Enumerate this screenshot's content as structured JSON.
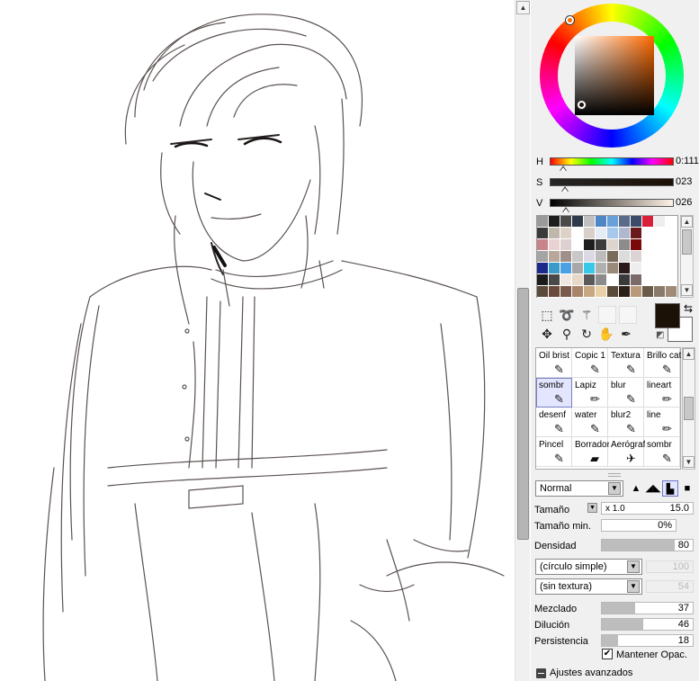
{
  "colors": {
    "main_color": "#1c1106",
    "sub_color": "#ffffff",
    "hue_marker": "#ff6a00"
  },
  "color_sliders": [
    {
      "label": "H",
      "value": "0:111",
      "caret_fraction": 0.07
    },
    {
      "label": "S",
      "value": "023",
      "caret_fraction": 0.09
    },
    {
      "label": "V",
      "value": "026",
      "caret_fraction": 0.1
    }
  ],
  "swatches": [
    "#9a9a9a",
    "#1d1d1d",
    "#4a4a4a",
    "#2f3a4a",
    "#c0c0c0",
    "#4f86c4",
    "#6aa0d8",
    "#5a6c8a",
    "#3a4c6a",
    "#d8203a",
    "#eeeeee",
    "#ffffff",
    "#3a3a3a",
    "#bfb6ac",
    "#dcd2c8",
    "#ffffff",
    "#d8d0c8",
    "#e6ecf5",
    "#a6c8ec",
    "#b0b8d0",
    "#6a1a1a",
    "#ffffff",
    "#ffffff",
    "#ffffff",
    "#c8848a",
    "#e8d2d2",
    "#dcd0d0",
    "#ffffff",
    "#1e1e1e",
    "#3c3c3c",
    "#dcd4ce",
    "#8c8c8c",
    "#7a0a0a",
    "#ffffff",
    "#ffffff",
    "#ffffff",
    "#a4a4a4",
    "#b8a89c",
    "#a0908a",
    "#c8c8c8",
    "#dcd8e4",
    "#bcbcbc",
    "#7a6a5a",
    "#dcdcdc",
    "#dcd4d4",
    "#ffffff",
    "#ffffff",
    "#ffffff",
    "#1a2a8a",
    "#3a9ac8",
    "#4aa0e0",
    "#a8a8a8",
    "#38c8e8",
    "#b0b0b0",
    "#9a8a7a",
    "#2a1a1a",
    "#eeeeee",
    "#ffffff",
    "#ffffff",
    "#ffffff",
    "#1c1c1c",
    "#4a4a4a",
    "#f0e8e0",
    "#e8d8c8",
    "#5a5a5a",
    "#8c8c8c",
    "#ffffff",
    "#3a3a3a",
    "#7a6a6a",
    "#ffffff",
    "#ffffff",
    "#ffffff",
    "#5a4a3a",
    "#6a4a3a",
    "#7a5a4a",
    "#a8846a",
    "#c8a882",
    "#e8d0a8",
    "#5a4a3a",
    "#2a2018",
    "#b89a7a",
    "#6a5a4a",
    "#8a7a6a",
    "#a08a78"
  ],
  "tools_row1": [
    "select-rect-icon",
    "lasso-icon",
    "magic-wand-icon",
    "",
    ""
  ],
  "tools_row2": [
    "move-icon",
    "zoom-icon",
    "rotate-icon",
    "hand-icon",
    "eyedropper-icon"
  ],
  "brushes": [
    {
      "name": "Oil brist",
      "icon": "✎"
    },
    {
      "name": "Copic 1",
      "icon": "✎"
    },
    {
      "name": "Textura",
      "icon": "✎"
    },
    {
      "name": "Brillo cat",
      "icon": "✎"
    },
    {
      "name": "sombr",
      "icon": "✎",
      "selected": true
    },
    {
      "name": "Lapiz",
      "icon": "✏"
    },
    {
      "name": "blur",
      "icon": "✎"
    },
    {
      "name": "lineart",
      "icon": "✏"
    },
    {
      "name": "desenf",
      "icon": "✎"
    },
    {
      "name": "water",
      "icon": "✎"
    },
    {
      "name": "blur2",
      "icon": "✎"
    },
    {
      "name": "line",
      "icon": "✏"
    },
    {
      "name": "Pincel",
      "icon": "✎"
    },
    {
      "name": "Borrador",
      "icon": "▰"
    },
    {
      "name": "Aerógraf",
      "icon": "✈"
    },
    {
      "name": "sombr",
      "icon": "✎"
    }
  ],
  "blend_mode": "Normal",
  "size": {
    "label": "Tamaño",
    "multiplier": "x 1.0",
    "value": "15.0"
  },
  "min_size": {
    "label": "Tamaño min.",
    "value": "0%"
  },
  "density": {
    "label": "Densidad",
    "value": "80",
    "fraction": 0.8
  },
  "shape_select": {
    "value": "(círculo simple)",
    "amount": "100"
  },
  "texture_select": {
    "value": "(sin textura)",
    "amount": "54"
  },
  "mixing": {
    "label": "Mezclado",
    "value": "37",
    "fraction": 0.37
  },
  "dilution": {
    "label": "Dilución",
    "value": "46",
    "fraction": 0.46
  },
  "persistence": {
    "label": "Persistencia",
    "value": "18",
    "fraction": 0.18
  },
  "keep_opacity": {
    "label": "Mantener Opac.",
    "checked": true
  },
  "advanced": {
    "label": "Ajustes avanzados"
  }
}
